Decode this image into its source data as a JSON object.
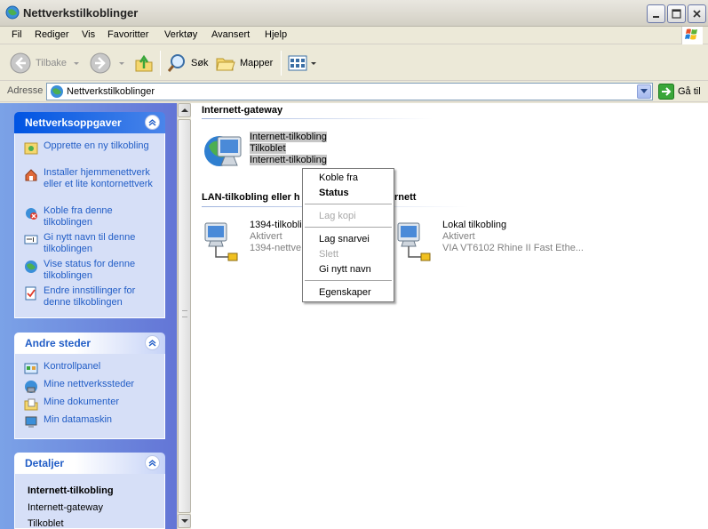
{
  "window": {
    "title": "Nettverkstilkoblinger"
  },
  "menu": [
    "Fil",
    "Rediger",
    "Vis",
    "Favoritter",
    "Verktøy",
    "Avansert",
    "Hjelp"
  ],
  "toolbar": {
    "back_label": "Tilbake",
    "search_label": "Søk",
    "folders_label": "Mapper"
  },
  "address": {
    "label": "Adresse",
    "value": "Nettverkstilkoblinger",
    "go_label": "Gå til"
  },
  "taskpane": {
    "network_tasks": {
      "title": "Nettverksoppgaver",
      "items": [
        "Opprette en ny tilkobling",
        "Installer hjemmenettverk eller et lite kontornettverk",
        "Koble fra denne tilkoblingen",
        "Gi nytt navn til denne tilkoblingen",
        "Vise status for denne tilkoblingen",
        "Endre innstillinger for denne tilkoblingen"
      ]
    },
    "other_places": {
      "title": "Andre steder",
      "items": [
        "Kontrollpanel",
        "Mine nettverkssteder",
        "Mine dokumenter",
        "Min datamaskin"
      ]
    },
    "details": {
      "title": "Detaljer",
      "name": "Internett-tilkobling",
      "type": "Internett-gateway",
      "status": "Tilkoblet"
    }
  },
  "groups": {
    "gateway": {
      "title": "Internett-gateway",
      "connection": {
        "name": "Internett-tilkobling",
        "status": "Tilkoblet",
        "device": "Internett-tilkobling"
      }
    },
    "lan": {
      "title_left": "LAN-tilkobling eller h",
      "title_right": "rnett",
      "connections": [
        {
          "name": "1394-tilkobli",
          "status": "Aktivert",
          "device": "1394-nettve"
        },
        {
          "name": "Lokal tilkobling",
          "status": "Aktivert",
          "device": "VIA VT6102 Rhine II Fast Ethe..."
        }
      ]
    }
  },
  "context_menu": {
    "items": [
      {
        "label": "Koble fra",
        "state": "normal"
      },
      {
        "label": "Status",
        "state": "bold"
      },
      {
        "label": "Lag kopi",
        "state": "disabled"
      },
      {
        "label": "Lag snarvei",
        "state": "normal"
      },
      {
        "label": "Slett",
        "state": "disabled"
      },
      {
        "label": "Gi nytt navn",
        "state": "normal"
      },
      {
        "label": "Egenskaper",
        "state": "normal"
      }
    ]
  },
  "colors": {
    "xp_blue": "#0054e3",
    "task_link": "#215dc6",
    "pane_gradient_start": "#7ba2e7",
    "pane_gradient_end": "#6375d6",
    "selection_gray": "#c6c6c6"
  },
  "icons": {
    "app": "network-connections-icon",
    "gateway": "internet-gateway-icon",
    "lan": "lan-connection-icon"
  }
}
